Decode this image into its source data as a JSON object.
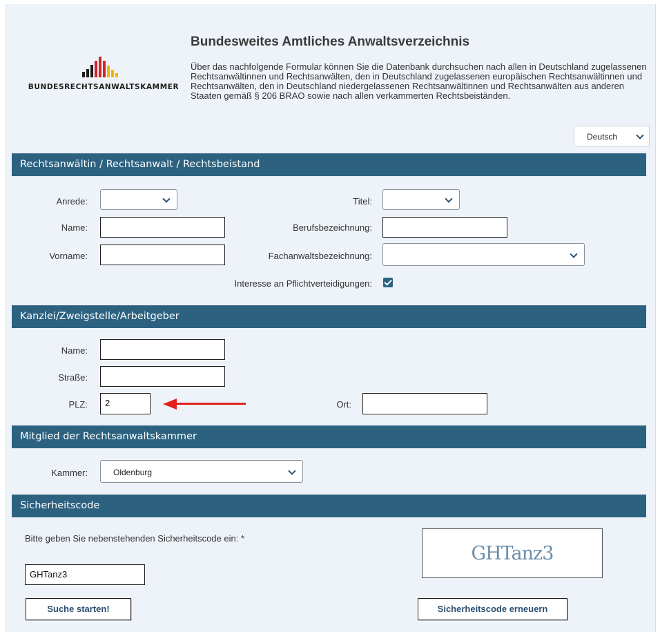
{
  "header": {
    "logo_text": "BUNDESRECHTSANWALTSKAMMER",
    "title": "Bundesweites Amtliches Anwaltsverzeichnis",
    "intro": "Über das nachfolgende Formular können Sie die Datenbank durchsuchen nach allen in Deutschland zugelassenen Rechtsanwältinnen und Rechtsanwälten, den in Deutschland zugelassenen europäischen Rechtsanwältinnen und Rechtsanwälten, den in Deutschland niedergelassenen Rechtsanwältinnen und Rechtsanwälten aus anderen Staaten gemäß § 206 BRAO sowie nach allen verkammerten Rechtsbeiständen.",
    "language": "Deutsch"
  },
  "colors": {
    "section_bar": "#2c6280",
    "arrow": "#e0201d",
    "logo_red": "#d4232a",
    "logo_gold": "#f2b705",
    "logo_dark": "#1d1d1b"
  },
  "section_person": {
    "heading": "Rechtsanwältin / Rechtsanwalt / Rechtsbeistand",
    "anrede_label": "Anrede:",
    "anrede_value": "",
    "titel_label": "Titel:",
    "titel_value": "",
    "name_label": "Name:",
    "name_value": "",
    "beruf_label": "Berufsbezeichnung:",
    "beruf_value": "",
    "vorname_label": "Vorname:",
    "vorname_value": "",
    "fachanwalt_label": "Fachanwaltsbezeichnung:",
    "fachanwalt_value": "",
    "pflicht_label": "Interesse an Pflichtverteidigungen:",
    "pflicht_checked": true
  },
  "section_kanzlei": {
    "heading": "Kanzlei/Zweigstelle/Arbeitgeber",
    "name_label": "Name:",
    "name_value": "",
    "strasse_label": "Straße:",
    "strasse_value": "",
    "plz_label": "PLZ:",
    "plz_value": "2",
    "ort_label": "Ort:",
    "ort_value": ""
  },
  "section_kammer": {
    "heading": "Mitglied der Rechtsanwaltskammer",
    "kammer_label": "Kammer:",
    "kammer_value": "Oldenburg"
  },
  "section_captcha": {
    "heading": "Sicherheitscode",
    "prompt": "Bitte geben Sie nebenstehenden Sicherheitscode ein: *",
    "input_value": "GHTanz3",
    "image_text": "GHTanz3",
    "search_button": "Suche starten!",
    "renew_button": "Sicherheitscode erneuern"
  }
}
